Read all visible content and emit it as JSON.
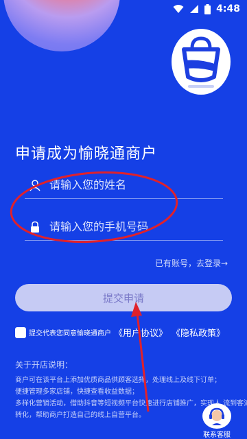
{
  "status_bar": {
    "time": "4:48"
  },
  "form": {
    "title": "申请成为愉晓通商户",
    "name_placeholder": "请输入您的姓名",
    "phone_placeholder": "请输入您的手机号码",
    "login_link": "已有账号，去登录→",
    "submit_label": "提交申请"
  },
  "agreement": {
    "prefix": "提交代表您同意愉晓通商户",
    "user_agreement": "《用户协议》",
    "privacy_policy": "《隐私政策》"
  },
  "notes": {
    "heading": "关于开店说明：",
    "lines": [
      "商户可在该平台上添加优质商品供顾客选择，处理线上及线下订单；",
      "便捷管理多家店铺，快捷查看收益数据；",
      "多样化营销活动，借助抖音等短视频平台快速进行店铺推广，实现人 流到客流的",
      "转化，帮助商户打造自己的线上自营平台。"
    ]
  },
  "service": {
    "label": "联系客服"
  },
  "colors": {
    "background": "#1540e6",
    "submit_bg": "#c6cbf4",
    "submit_text": "#7a79c8",
    "annotation": "#e0212b"
  }
}
